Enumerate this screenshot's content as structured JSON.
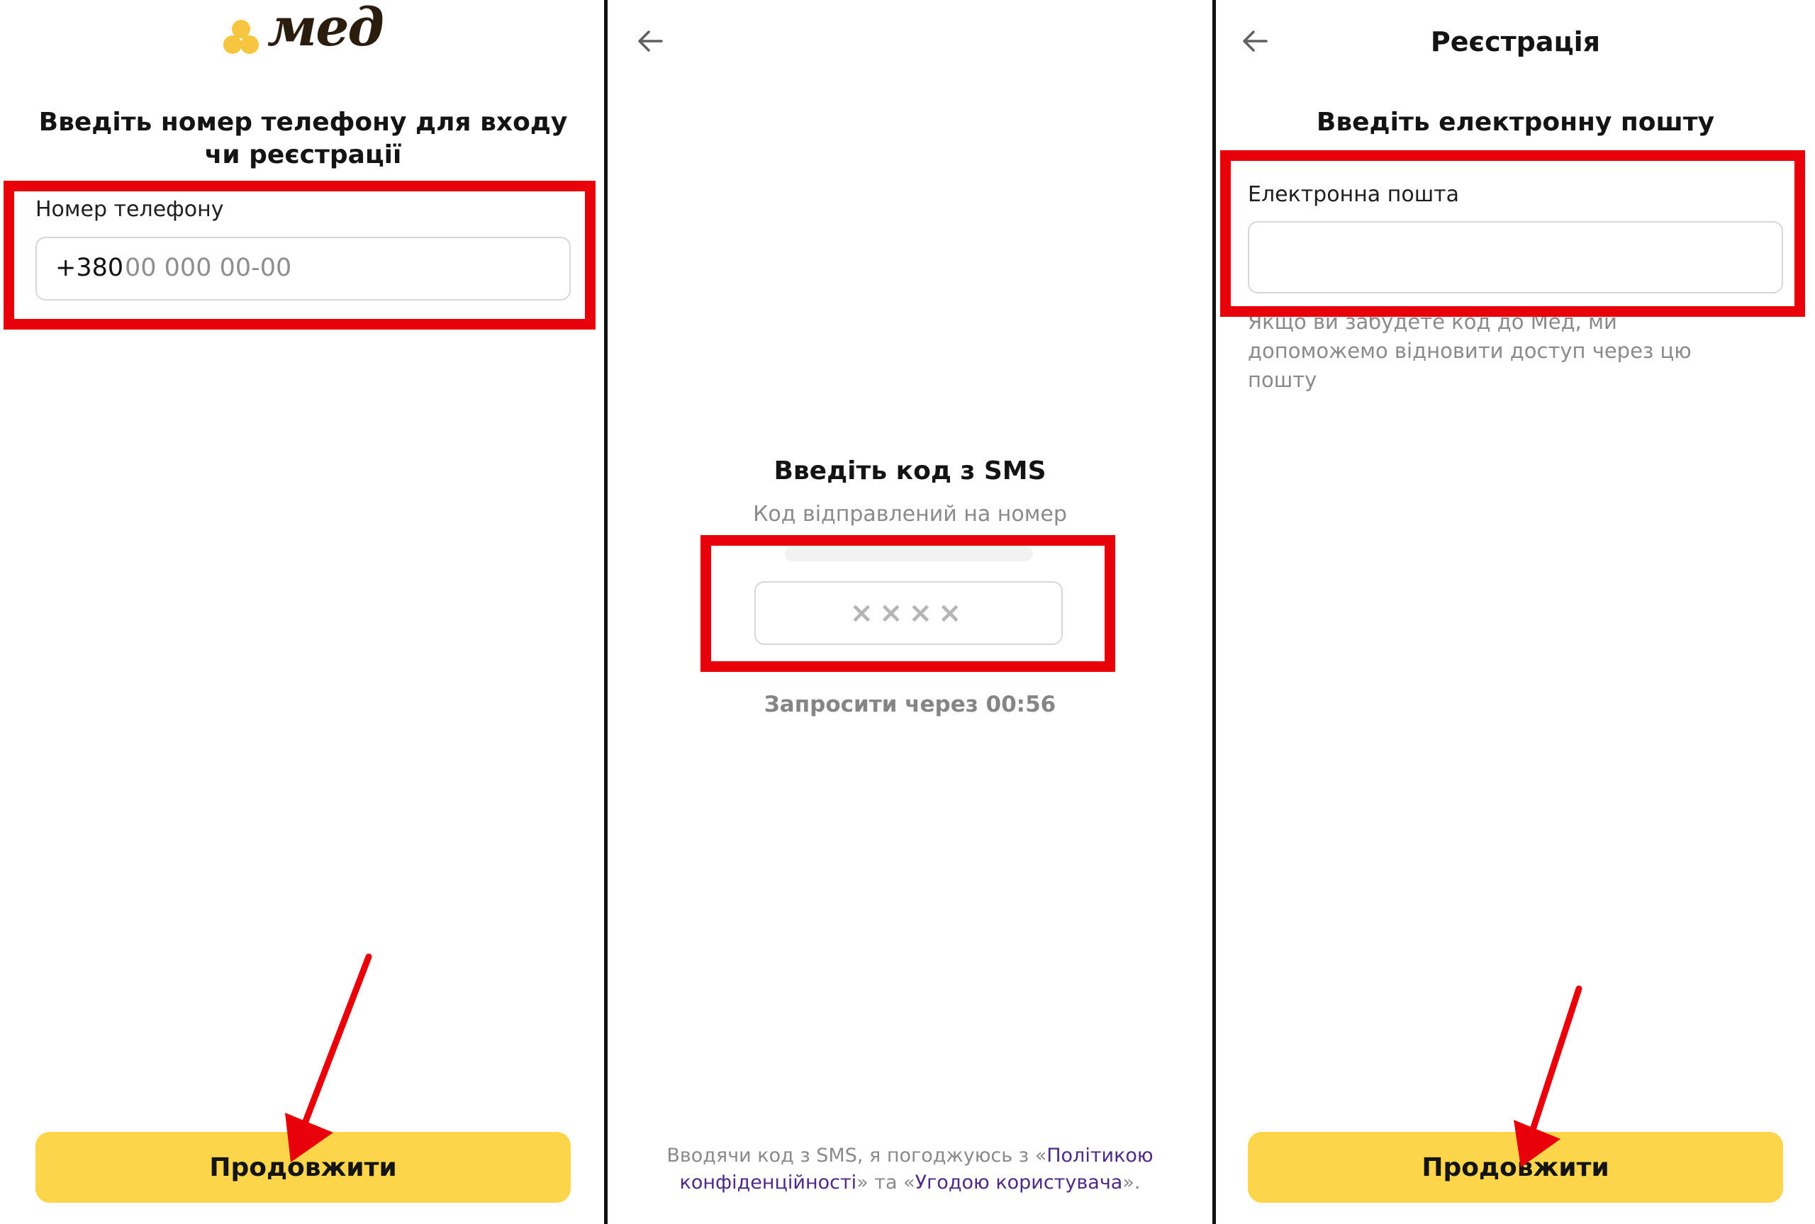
{
  "screen1": {
    "logo_text": "мед",
    "title": "Введіть номер телефону для входу чи реєстрації",
    "phone_label": "Номер телефону",
    "phone_prefix": "+380",
    "phone_placeholder": "00 000 00-00",
    "continue_label": "Продовжити"
  },
  "screen2": {
    "title": "Введіть код з SMS",
    "subtitle": "Код відправлений на номер",
    "code_placeholder": "××××",
    "resend_text": "Запросити через 00:56",
    "terms_prefix": "Вводячи код з SMS, я погоджуюсь з «",
    "terms_link1": "Політикою конфіденційності",
    "terms_middle": "» та «",
    "terms_link2": "Угодою користувача",
    "terms_suffix": "»."
  },
  "screen3": {
    "header_title": "Реєстрація",
    "title": "Введіть електронну пошту",
    "email_label": "Електронна пошта",
    "email_value": "",
    "help_text": "Якщо ви забудете код до Мед, ми допоможемо відновити доступ через цю пошту",
    "continue_label": "Продовжити"
  },
  "colors": {
    "accent_yellow": "#fcd54a",
    "highlight_red": "#e8000b",
    "link_purple": "#4c2a86",
    "logo_brown": "#2b1d0e",
    "logo_yellow": "#f7c640"
  }
}
